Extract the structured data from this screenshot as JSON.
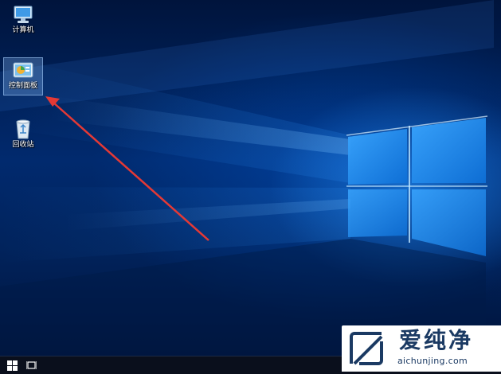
{
  "desktop": {
    "icons": [
      {
        "label": "计算机",
        "icon": "computer-icon",
        "selected": false
      },
      {
        "label": "控制面板",
        "icon": "control-panel-icon",
        "selected": true
      },
      {
        "label": "回收站",
        "icon": "recycle-bin-icon",
        "selected": false
      }
    ],
    "annotation": {
      "color": "#e53935",
      "target": "控制面板"
    }
  },
  "taskbar": {
    "start_icon": "windows-logo-icon",
    "task_view_icon": "task-view-icon"
  },
  "watermark": {
    "title": "爱纯净",
    "url": "aichunjing.com",
    "color": "#1b3a63"
  }
}
